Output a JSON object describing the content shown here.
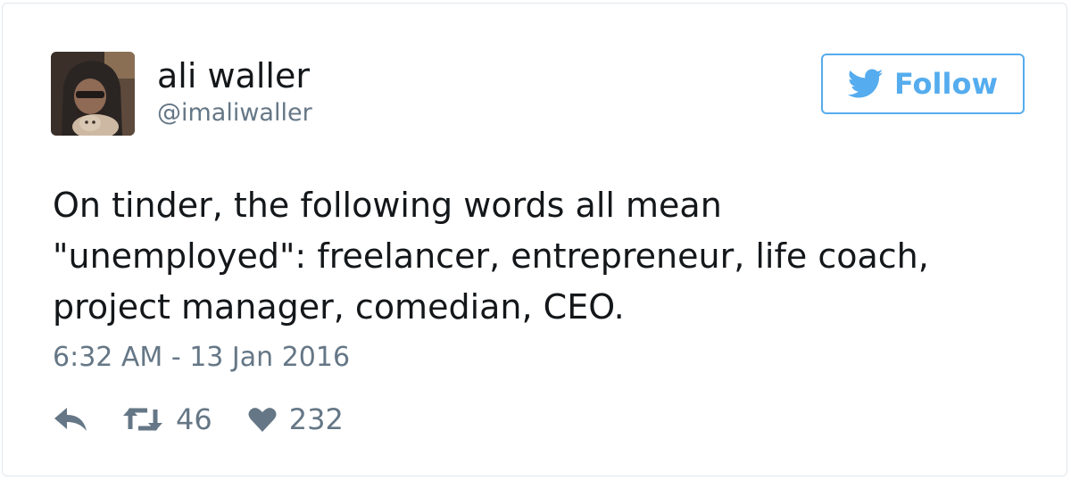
{
  "tweet": {
    "author_name": "ali waller",
    "author_handle": "@imaliwaller",
    "follow_label": "Follow",
    "text_lines": [
      "On tinder, the following words all mean",
      "\"unemployed\": freelancer, entrepreneur, life coach,",
      "project manager, comedian, CEO."
    ],
    "timestamp": "6:32 AM - 13 Jan 2016",
    "retweet_count": "46",
    "like_count": "232"
  },
  "icons": {
    "follow": "twitter-bird-icon",
    "reply": "reply-icon",
    "retweet": "retweet-icon",
    "like": "heart-icon"
  },
  "colors": {
    "brand_blue": "#55acee",
    "text_primary": "#14171a",
    "text_secondary": "#657786",
    "border": "#e1e8ed"
  }
}
